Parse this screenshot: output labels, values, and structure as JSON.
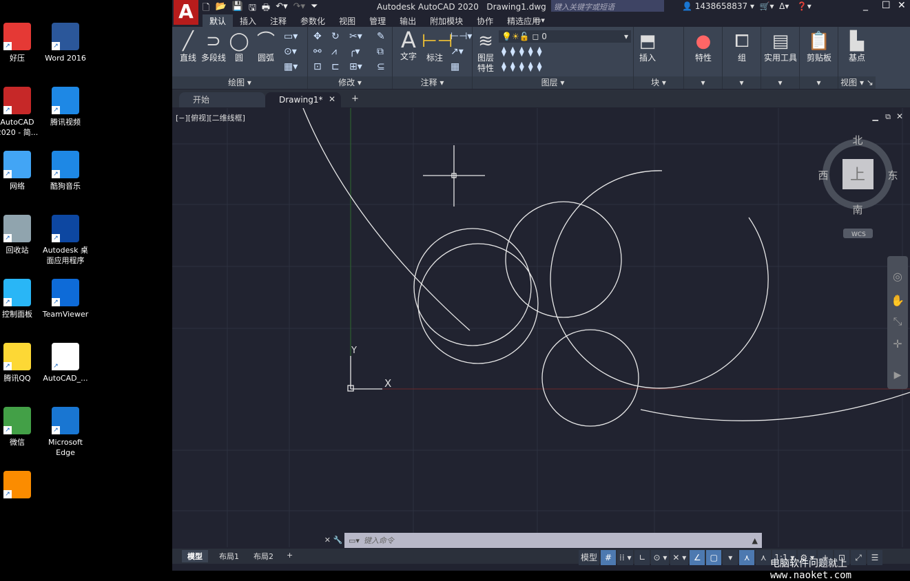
{
  "desktop": {
    "icons": [
      {
        "label": "好压",
        "color": "#e53935"
      },
      {
        "label": "Word 2016",
        "color": "#2b579a"
      },
      {
        "label": "AutoCAD 2020 - 简...",
        "color": "#c62828"
      },
      {
        "label": "腾讯视频",
        "color": "#1e88e5"
      },
      {
        "label": "网络",
        "color": "#42a5f5"
      },
      {
        "label": "酷狗音乐",
        "color": "#1e88e5"
      },
      {
        "label": "回收站",
        "color": "#90a4ae"
      },
      {
        "label": "Autodesk 桌面应用程序",
        "color": "#0d47a1"
      },
      {
        "label": "控制面板",
        "color": "#29b6f6"
      },
      {
        "label": "TeamViewer",
        "color": "#0e6bd8"
      },
      {
        "label": "腾讯QQ",
        "color": "#fdd835"
      },
      {
        "label": "AutoCAD_...",
        "color": "#ffffff"
      },
      {
        "label": "微信",
        "color": "#43a047"
      },
      {
        "label": "Microsoft Edge",
        "color": "#1976d2"
      },
      {
        "label": "",
        "color": "#fb8c00"
      }
    ]
  },
  "titlebar": {
    "app": "Autodesk AutoCAD 2020",
    "file": "Drawing1.dwg",
    "search_placeholder": "键入关键字或短语",
    "user": "1438658837",
    "logo": "A"
  },
  "ribbon_tabs": [
    "默认",
    "插入",
    "注释",
    "参数化",
    "视图",
    "管理",
    "输出",
    "附加模块",
    "协作",
    "精选应用"
  ],
  "panels": {
    "draw": {
      "title": "绘图",
      "tools": [
        "直线",
        "多段线",
        "圆",
        "圆弧"
      ]
    },
    "modify": {
      "title": "修改"
    },
    "annotate": {
      "title": "注释",
      "tools": [
        "文字",
        "标注"
      ]
    },
    "layers": {
      "title": "图层",
      "tool": "图层特性",
      "current_layer": "0"
    },
    "block": {
      "title": "块",
      "tool": "插入"
    },
    "properties": {
      "tool": "特性"
    },
    "groups": {
      "tool": "组"
    },
    "utilities": {
      "tool": "实用工具"
    },
    "clipboard": {
      "tool": "剪贴板"
    },
    "view": {
      "title": "视图",
      "tool": "基点"
    }
  },
  "doc_tabs": {
    "start": "开始",
    "drawing": "Drawing1*"
  },
  "viewport": {
    "label": "[−][俯视][二维线框]",
    "compass": {
      "n": "北",
      "s": "南",
      "e": "东",
      "w": "西",
      "top": "上"
    },
    "wcs": "WCS",
    "ucs_x": "X",
    "ucs_y": "Y"
  },
  "command": {
    "placeholder": "键入命令"
  },
  "layout_tabs": [
    "模型",
    "布局1",
    "布局2"
  ],
  "status": {
    "model": "模型",
    "scale": "1:1"
  },
  "watermark": "电脑软件问题就上www.naoket.com"
}
